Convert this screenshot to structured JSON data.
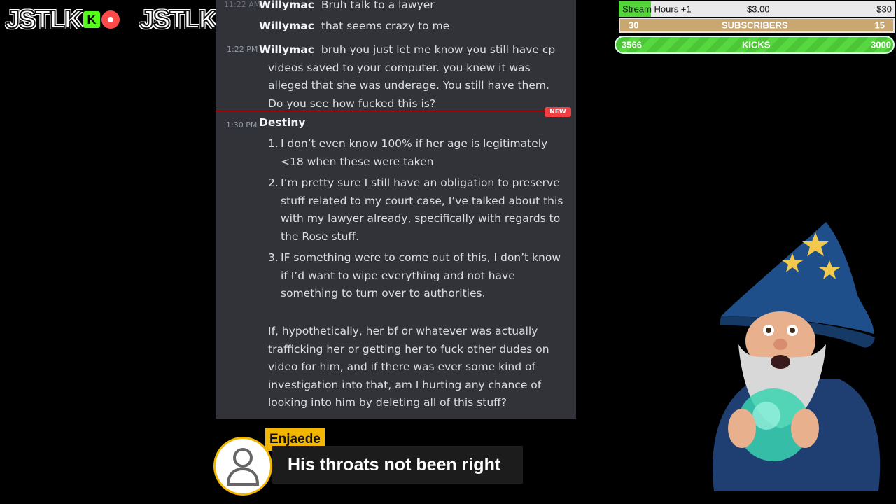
{
  "logos": {
    "kick_logo_text": "JSTLK",
    "twitter_logo_text": "JSTLK"
  },
  "chat": {
    "messages": [
      {
        "time": "11:22 AM",
        "author": "Willymac",
        "text": "Bruh talk to a lawyer"
      },
      {
        "author": "Willymac",
        "text": "that seems crazy to me"
      },
      {
        "time": "1:22 PM",
        "author": "Willymac",
        "lines": [
          "bruh you just let me know you still have cp",
          "videos saved to your computer. you knew it was",
          "alleged that she was underage. You still have them.",
          "Do you see how fucked this is?"
        ]
      }
    ],
    "new_badge": "NEW",
    "destiny_message": {
      "time": "1:30 PM",
      "author": "Destiny",
      "list": [
        {
          "num": "1.",
          "text": "I don’t even know 100% if her age is legitimately <18 when these were taken"
        },
        {
          "num": "2.",
          "text": "I’m pretty sure I still have an obligation to preserve stuff related to my court case, I’ve talked about this with my lawyer already, specifically with regards to the Rose stuff."
        },
        {
          "num": "3.",
          "text": "IF something were to come out of this, I don’t know if I’d want to wipe everything and not have something to turn over to authorities."
        }
      ],
      "paragraph": "If, hypothetically, her bf or whatever was actually trafficking her or getting her to fuck other dudes on video for him, and if there was ever some kind of investigation into that, am I hurting any chance of looking into him by deleting all of this stuff?"
    }
  },
  "caption": {
    "name": "Enjaede",
    "text": "His throats not been right"
  },
  "goals": {
    "hours": {
      "label": "Stream Hours +1",
      "amount": "$3.00",
      "goal": "$30"
    },
    "subs": {
      "current": "30",
      "label": "SUBSCRIBERS",
      "goal": "15"
    },
    "kicks": {
      "current": "3566",
      "label": "KICKS",
      "goal": "3000"
    }
  },
  "colors": {
    "chat_bg": "#313338",
    "new_red": "#f23f43",
    "caption_gold": "#f2b600",
    "kick_green": "#53fc18"
  },
  "icons": [
    "kick-icon",
    "live-icon",
    "twitter-icon",
    "user-icon",
    "wizard-mascot"
  ]
}
